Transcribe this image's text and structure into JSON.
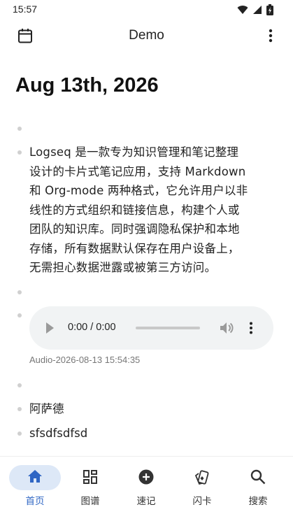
{
  "status_bar": {
    "time": "15:57"
  },
  "app_bar": {
    "title": "Demo"
  },
  "journal": {
    "date_title": "Aug 13th, 2026",
    "blocks": {
      "paragraph_lines": [
        "Logseq 是一款专为知识管理和笔记整理",
        "设计的卡片式笔记应用，支持 Markdown",
        "和 Org-mode 两种格式，它允许用户以非",
        "线性的方式组织和链接信息，构建个人或",
        "团队的知识库。同时强调隐私保护和本地",
        "存储，所有数据默认保存在用户设备上，",
        "无需担心数据泄露或被第三方访问。"
      ],
      "audio": {
        "time_display": "0:00 / 0:00",
        "caption": "Audio-2026-08-13 15:54:35"
      },
      "text_1": "阿萨德",
      "text_2": "sfsdfsdfsd"
    }
  },
  "bottom_nav": {
    "active": "home",
    "items": [
      {
        "key": "home",
        "label": "首页",
        "icon": "home-icon"
      },
      {
        "key": "graph",
        "label": "图谱",
        "icon": "grid-icon"
      },
      {
        "key": "quick-note",
        "label": "速记",
        "icon": "add-circle-icon"
      },
      {
        "key": "flashcards",
        "label": "闪卡",
        "icon": "cards-icon"
      },
      {
        "key": "search",
        "label": "搜索",
        "icon": "search-icon"
      }
    ]
  },
  "colors": {
    "accent": "#2f66c4",
    "nav_active_bg": "#dde8f7",
    "bullet": "#d0d0d0",
    "audio_bg": "#f1f3f4"
  }
}
